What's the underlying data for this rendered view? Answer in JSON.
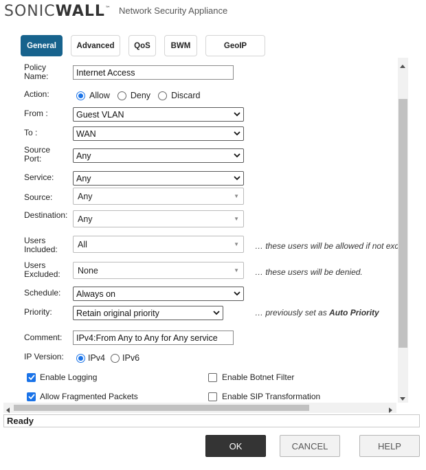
{
  "header": {
    "logo_text_a": "SONIC",
    "logo_text_b": "WALL",
    "logo_tm": "™",
    "subtitle": "Network Security Appliance"
  },
  "tabs": [
    {
      "label": "General",
      "active": true
    },
    {
      "label": "Advanced",
      "active": false
    },
    {
      "label": "QoS",
      "active": false
    },
    {
      "label": "BWM",
      "active": false
    },
    {
      "label": "GeoIP",
      "active": false
    }
  ],
  "form": {
    "policy_name_label": "Policy Name:",
    "policy_name_value": "Internet Access",
    "action_label": "Action:",
    "action_options": [
      "Allow",
      "Deny",
      "Discard"
    ],
    "action_selected": "Allow",
    "from_label": "From :",
    "from_value": "Guest VLAN",
    "to_label": "To :",
    "to_value": "WAN",
    "source_port_label": "Source Port:",
    "source_port_value": "Any",
    "service_label": "Service:",
    "service_value": "Any",
    "source_label": "Source:",
    "source_value": "Any",
    "destination_label": "Destination:",
    "destination_value": "Any",
    "users_included_label": "Users Included:",
    "users_included_value": "All",
    "users_included_hint": "… these users will be allowed if not exc",
    "users_excluded_label": "Users Excluded:",
    "users_excluded_value": "None",
    "users_excluded_hint": "… these users will be denied.",
    "schedule_label": "Schedule:",
    "schedule_value": "Always on",
    "priority_label": "Priority:",
    "priority_value": "Retain original priority",
    "priority_hint_prefix": "… previously set as ",
    "priority_hint_bold": "Auto Priority",
    "comment_label": "Comment:",
    "comment_value": "IPv4:From Any to Any for Any service",
    "ip_version_label": "IP Version:",
    "ip_version_options": [
      "IPv4",
      "IPv6"
    ],
    "ip_version_selected": "IPv4",
    "checkboxes": [
      {
        "label": "Enable Logging",
        "checked": true
      },
      {
        "label": "Enable Botnet Filter",
        "checked": false
      },
      {
        "label": "Allow Fragmented Packets",
        "checked": true
      },
      {
        "label": "Enable SIP Transformation",
        "checked": false
      }
    ]
  },
  "status": {
    "text": "Ready"
  },
  "buttons": {
    "ok": "OK",
    "cancel": "CANCEL",
    "help": "HELP"
  },
  "colors": {
    "tab_active": "#17638d",
    "primary_button": "#343434",
    "radio_accent": "#1a73e8"
  }
}
